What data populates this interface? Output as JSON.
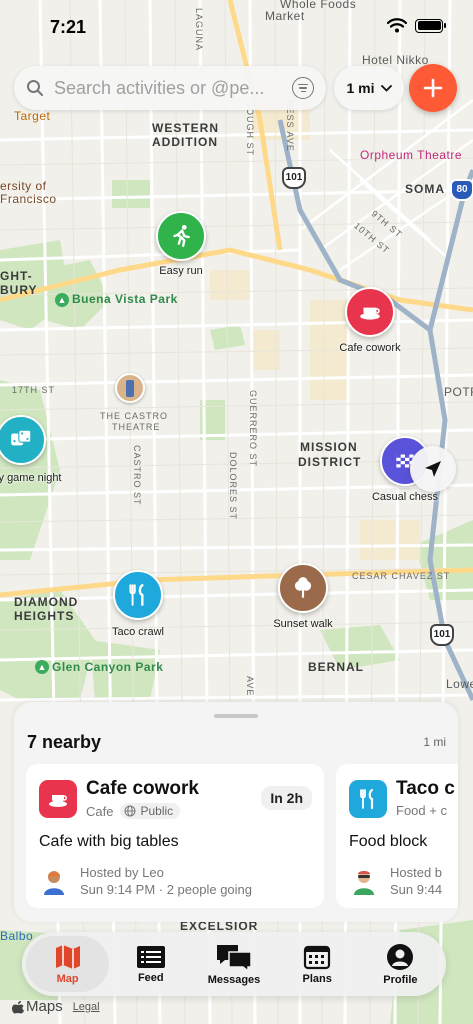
{
  "status_bar": {
    "time": "7:21"
  },
  "search": {
    "placeholder": "Search activities or @pe..."
  },
  "radius": {
    "label": "1 mi"
  },
  "map": {
    "labels": {
      "whole_foods": "Whole Foods",
      "market": "Market",
      "hotel_nikko": "Hotel Nikko",
      "target": "Target",
      "western_addition_1": "WESTERN",
      "western_addition_2": "ADDITION",
      "orpheum": "Orpheum Theatre",
      "soma": "SOMA",
      "univ_1": "ersity of",
      "univ_2": "Francisco",
      "ght_1": "GHT-",
      "ght_2": "BURY",
      "buena_vista": "Buena Vista Park",
      "castro_theatre_1": "THE CASTRO",
      "castro_theatre_2": "THEATRE",
      "seventeenth": "17TH ST",
      "mission_1": "MISSION",
      "mission_2": "DISTRICT",
      "potr": "POTR",
      "diamond_1": "DIAMOND",
      "diamond_2": "HEIGHTS",
      "glen_canyon": "Glen Canyon Park",
      "cesar_chavez": "CESAR CHAVEZ ST",
      "bernal": "BERNAL",
      "lowe": "Lowe",
      "excelsior": "EXCELSIOR",
      "balbo": "Balbo",
      "laguna": "LAGUNA",
      "gough": "GOUGH ST",
      "van_ness": "NESS AVE",
      "ninth": "9TH ST",
      "tenth": "10TH ST",
      "castro_st": "CASTRO ST",
      "dolores": "DOLORES ST",
      "guerrero": "GUERRERO ST",
      "ave": "AVE"
    },
    "highways": {
      "h101a": "101",
      "h80": "80",
      "h101b": "101"
    },
    "pins": [
      {
        "label": "Easy run",
        "icon": "running-icon",
        "color": "#2fb34a"
      },
      {
        "label": "Cafe cowork",
        "icon": "coffee-cup-icon",
        "color": "#e8354d"
      },
      {
        "label": "y game night",
        "icon": "dice-icon",
        "color": "#22b1c4"
      },
      {
        "label": "Casual chess",
        "icon": "chessboard-icon",
        "color": "#5a52d9"
      },
      {
        "label": "Taco crawl",
        "icon": "fork-knife-icon",
        "color": "#1fa8db"
      },
      {
        "label": "Sunset walk",
        "icon": "tree-icon",
        "color": "#9a6a4b"
      }
    ]
  },
  "sheet": {
    "title": "7 nearby",
    "radius": "1 mi",
    "cards": [
      {
        "title": "Cafe cowork",
        "category": "Cafe",
        "visibility": "Public",
        "when": "In 2h",
        "description": "Cafe with big tables",
        "host": "Hosted by Leo",
        "details": "Sun 9:14 PM · 2 people going",
        "color": "#e8354d"
      },
      {
        "title": "Taco c",
        "category": "Food + c",
        "description": "Food block",
        "host": "Hosted b",
        "details": "Sun 9:44",
        "color": "#1fa8db"
      }
    ]
  },
  "tabs": [
    {
      "label": "Map",
      "icon": "map-icon",
      "active": true
    },
    {
      "label": "Feed",
      "icon": "list-icon"
    },
    {
      "label": "Messages",
      "icon": "chat-bubbles-icon"
    },
    {
      "label": "Plans",
      "icon": "calendar-icon"
    },
    {
      "label": "Profile",
      "icon": "person-icon"
    }
  ],
  "attribution": {
    "maps": "Maps",
    "legal": "Legal"
  },
  "colors": {
    "accent": "#ff5a36",
    "active_tab": "#e0462b"
  }
}
